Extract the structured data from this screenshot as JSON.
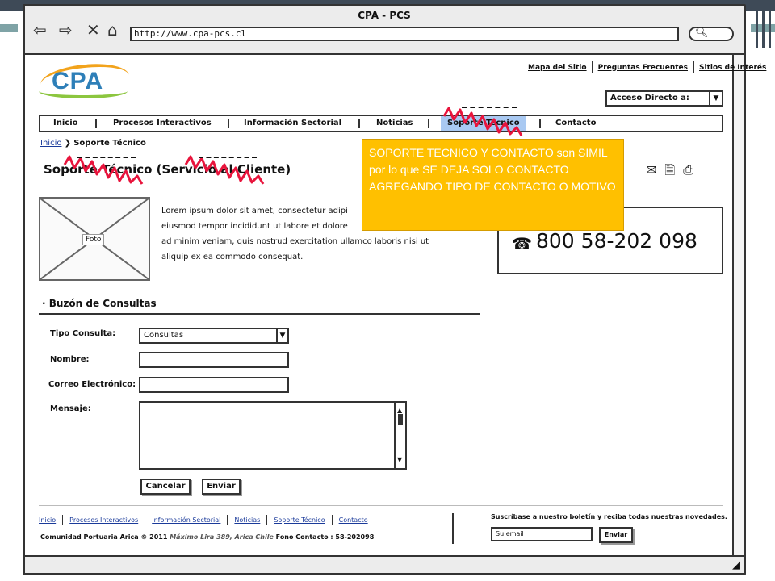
{
  "browser": {
    "title": "CPA - PCS",
    "url": "http://www.cpa-pcs.cl"
  },
  "top_links": [
    "Mapa del Sitio",
    "Preguntas Frecuentes",
    "Sitios de Interés"
  ],
  "access": {
    "label": "Acceso Directo a:"
  },
  "nav": [
    {
      "label": "Inicio"
    },
    {
      "label": "Procesos Interactivos"
    },
    {
      "label": "Información Sectorial"
    },
    {
      "label": "Noticias"
    },
    {
      "label": "Soporte Técnico"
    },
    {
      "label": "Contacto"
    }
  ],
  "breadcrumb": {
    "home": "Inicio",
    "current": "Soporte Técnico"
  },
  "page_title": "Soporte Técnico (Servicio al Cliente)",
  "photo_label": "Foto",
  "lorem": "Lorem ipsum dolor sit amet, consectetur adipi... eiusmod tempor incididunt ut labore et dolore ... ad minim veniam, quis nostrud exercitation ullamco laboris nisi ut aliquip ex ea commodo consequat.",
  "lorem_lines": [
    "Lorem ipsum dolor sit amet, consectetur adipi",
    "eiusmod tempor incididunt ut labore et dolore",
    "ad minim veniam, quis nostrud exercitation ullamco laboris nisi ut",
    "aliquip ex ea commodo consequat."
  ],
  "phone": "800 58-202 098",
  "note": "SOPORTE TECNICO Y CONTACTO son SIMIL por lo que SE DEJA SOLO CONTACTO AGREGANDO TIPO DE CONTACTO O MOTIVO",
  "form": {
    "section_title": "· Buzón de Consultas",
    "tipo_label": "Tipo Consulta:",
    "tipo_value": "Consultas",
    "nombre_label": "Nombre:",
    "correo_label": "Correo Electrónico:",
    "mensaje_label": "Mensaje:",
    "cancel": "Cancelar",
    "send": "Enviar"
  },
  "footer": {
    "links": [
      "Inicio",
      "Procesos Interactivos",
      "Información Sectorial",
      "Noticias",
      "Soporte Técnico",
      "Contacto"
    ],
    "copyright": "Comunidad Portuaria Arica © 2011",
    "address": "Máximo Lira 389, Arica Chile",
    "phone": "Fono Contacto : 58-202098",
    "newsletter_text": "Suscríbase a nuestro boletín y reciba todas nuestras novedades.",
    "email_placeholder": "Su email",
    "send": "Enviar"
  },
  "colors": {
    "note_bg": "#ffc000",
    "nav_active": "#a9c9f2",
    "redmark": "#e8143c"
  }
}
